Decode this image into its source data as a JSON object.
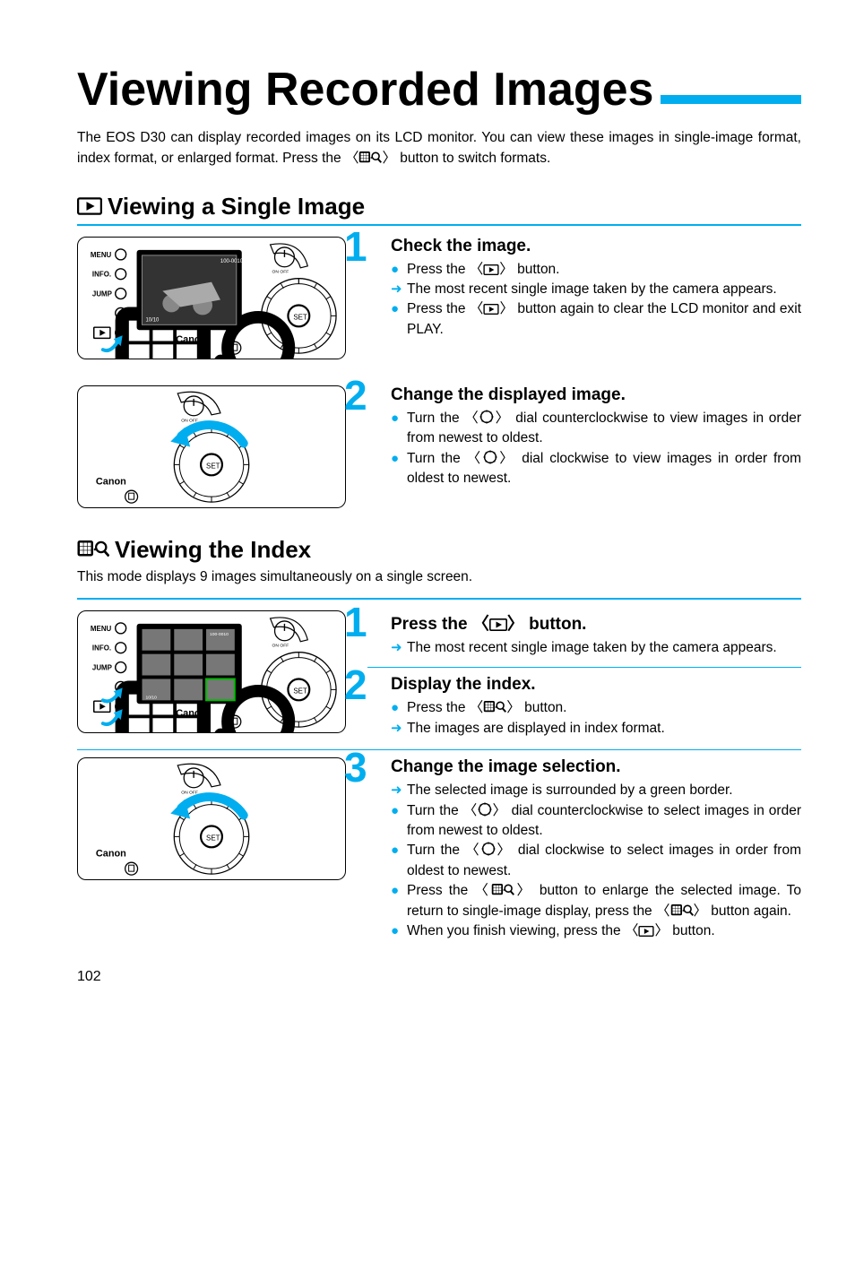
{
  "title": "Viewing Recorded Images",
  "intro_a": "The EOS D30 can display recorded images on its LCD monitor. You can view these images in single-image format, index format, or enlarged format. Press the 〈",
  "intro_b": "〉 button to switch formats.",
  "section1": {
    "heading": "Viewing a Single Image",
    "step1": {
      "num": "1",
      "title": "Check the image.",
      "b1a": "Press the 〈",
      "b1b": "〉 button.",
      "a1": "The most recent single image taken by the camera appears.",
      "b2a": "Press the 〈",
      "b2b": "〉 button again to clear the LCD monitor and exit PLAY."
    },
    "step2": {
      "num": "2",
      "title": "Change the displayed image.",
      "b1a": "Turn the 〈",
      "b1b": "〉 dial counterclockwise to view images in order from newest to oldest.",
      "b2a": "Turn the 〈",
      "b2b": "〉 dial clockwise to view images in order from oldest to newest."
    }
  },
  "section2": {
    "heading": "Viewing the Index",
    "sub": "This mode displays 9 images simultaneously on a single screen.",
    "step1": {
      "num": "1",
      "title_a": "Press the 〈",
      "title_b": "〉 button.",
      "a1": "The most recent single image taken by the camera appears."
    },
    "step2": {
      "num": "2",
      "title": "Display the index.",
      "b1a": "Press the 〈",
      "b1b": "〉 button.",
      "a1": "The images are displayed in index format."
    },
    "step3": {
      "num": "3",
      "title": "Change the image selection.",
      "a1": "The selected image is surrounded by a green border.",
      "b1a": "Turn the 〈",
      "b1b": "〉 dial counterclockwise to select images in order from newest to oldest.",
      "b2a": "Turn the 〈",
      "b2b": "〉 dial clockwise to select images in order from oldest to newest.",
      "b3a": "Press the 〈",
      "b3b": "〉 button to enlarge the selected image. To return to single-image display, press the 〈",
      "b3c": "〉 button again.",
      "b4a": "When you finish viewing, press the 〈",
      "b4b": "〉 button."
    }
  },
  "page_number": "102"
}
